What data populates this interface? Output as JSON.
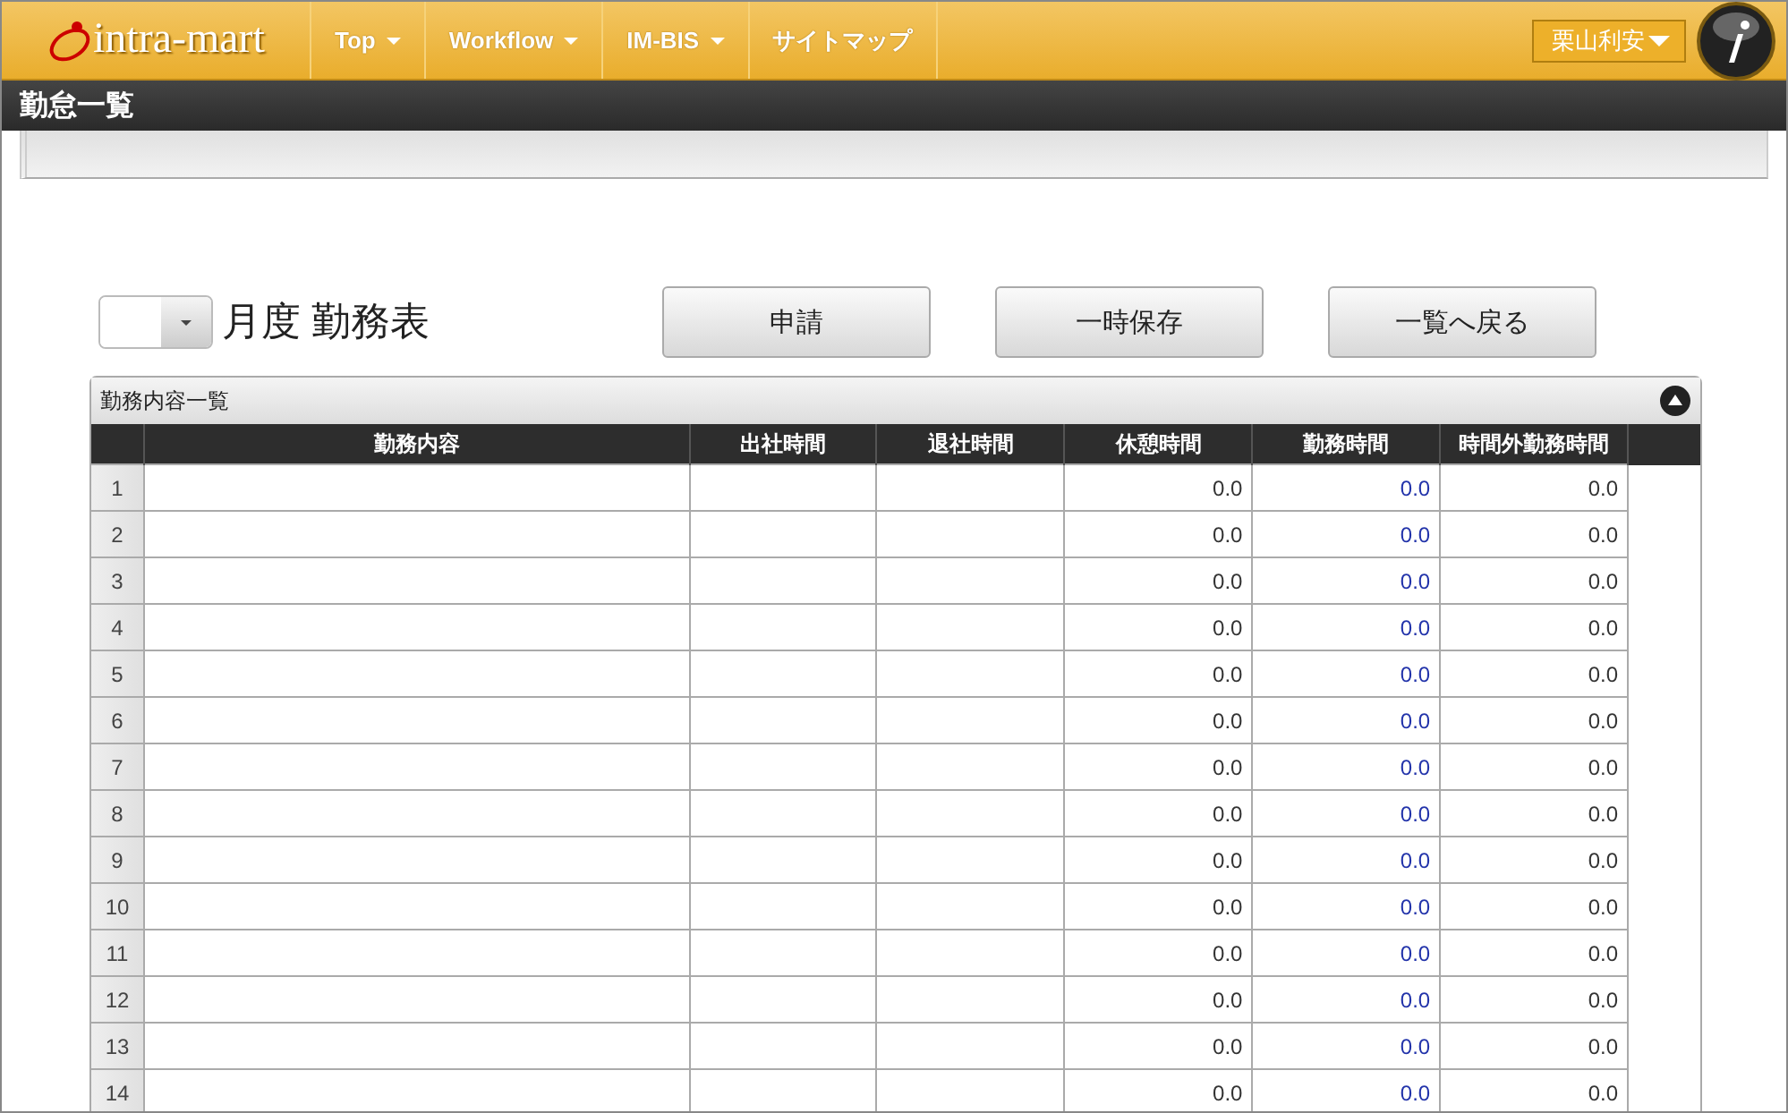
{
  "header": {
    "logo": "intra-mart",
    "menu": [
      {
        "label": "Top",
        "dropdown": true
      },
      {
        "label": "Workflow",
        "dropdown": true
      },
      {
        "label": "IM-BIS",
        "dropdown": true
      },
      {
        "label": "サイトマップ",
        "dropdown": false
      }
    ],
    "user": "栗山利安"
  },
  "page_title": "勤怠一覧",
  "form": {
    "month_select": {
      "suffix": "月度 勤務表"
    },
    "buttons": [
      "申請",
      "一時保存",
      "一覧へ戻る"
    ]
  },
  "panel": {
    "title": "勤務内容一覧",
    "expanded": true,
    "table": {
      "columns": [
        {
          "label": "勤務内容",
          "kind": "text"
        },
        {
          "label": "出社時間",
          "kind": "text"
        },
        {
          "label": "退社時間",
          "kind": "text"
        },
        {
          "label": "休憩時間",
          "kind": "number"
        },
        {
          "label": "勤務時間",
          "kind": "link"
        },
        {
          "label": "時間外勤務時間",
          "kind": "number"
        }
      ],
      "rows": [
        {
          "number": "1",
          "values": [
            "0.0",
            "0.0",
            "0.0"
          ]
        },
        {
          "number": "2",
          "values": [
            "0.0",
            "0.0",
            "0.0"
          ]
        },
        {
          "number": "3",
          "values": [
            "0.0",
            "0.0",
            "0.0"
          ]
        },
        {
          "number": "4",
          "values": [
            "0.0",
            "0.0",
            "0.0"
          ]
        },
        {
          "number": "5",
          "values": [
            "0.0",
            "0.0",
            "0.0"
          ]
        },
        {
          "number": "6",
          "values": [
            "0.0",
            "0.0",
            "0.0"
          ]
        },
        {
          "number": "7",
          "values": [
            "0.0",
            "0.0",
            "0.0"
          ]
        },
        {
          "number": "8",
          "values": [
            "0.0",
            "0.0",
            "0.0"
          ]
        },
        {
          "number": "9",
          "values": [
            "0.0",
            "0.0",
            "0.0"
          ]
        },
        {
          "number": "10",
          "values": [
            "0.0",
            "0.0",
            "0.0"
          ]
        },
        {
          "number": "11",
          "values": [
            "0.0",
            "0.0",
            "0.0"
          ]
        },
        {
          "number": "12",
          "values": [
            "0.0",
            "0.0",
            "0.0"
          ]
        },
        {
          "number": "13",
          "values": [
            "0.0",
            "0.0",
            "0.0"
          ]
        },
        {
          "number": "14",
          "values": [
            "0.0",
            "0.0",
            "0.0"
          ]
        }
      ]
    }
  }
}
